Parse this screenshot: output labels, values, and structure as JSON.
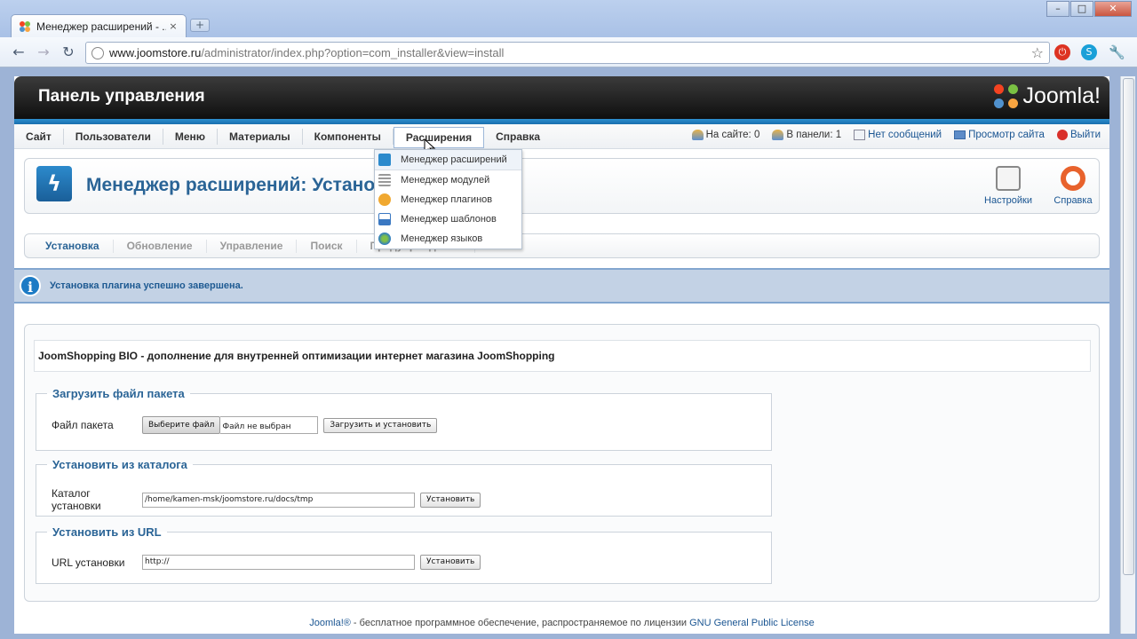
{
  "browser": {
    "tab_title": "Менеджер расширений - ...",
    "tab_close": "×",
    "new_tab": "+",
    "url_domain": "www.joomstore.ru",
    "url_path": "/administrator/index.php?option=com_installer&view=install",
    "win_min": "–",
    "win_max": "□",
    "win_close": "✕"
  },
  "header": {
    "admin_title": "Панель управления",
    "logo_text": "Joomla!"
  },
  "menu": {
    "items": [
      "Сайт",
      "Пользователи",
      "Меню",
      "Материалы",
      "Компоненты",
      "Расширения",
      "Справка"
    ],
    "active_index": 5
  },
  "status": {
    "on_site": "На сайте: 0",
    "in_panel": "В панели: 1",
    "messages": "Нет сообщений",
    "view_site": "Просмотр сайта",
    "logout": "Выйти"
  },
  "dropdown": {
    "items": [
      "Менеджер расширений",
      "Менеджер модулей",
      "Менеджер плагинов",
      "Менеджер шаблонов",
      "Менеджер языков"
    ]
  },
  "toolbar": {
    "page_title": "Менеджер расширений: Установка",
    "settings_label": "Настройки",
    "help_label": "Справка"
  },
  "subtabs": [
    "Установка",
    "Обновление",
    "Управление",
    "Поиск",
    "Предупреждения"
  ],
  "message": "Установка плагина успешно завершена.",
  "install": {
    "description": "JoomShopping BIO - дополнение для внутренней оптимизации интернет магазина JoomShopping",
    "upload": {
      "legend": "Загрузить файл пакета",
      "label": "Файл пакета",
      "choose_button": "Выберите файл",
      "no_file": "Файл не выбран",
      "submit": "Загрузить и установить"
    },
    "directory": {
      "legend": "Установить из каталога",
      "label": "Каталог установки",
      "value": "/home/kamen-msk/joomstore.ru/docs/tmp",
      "submit": "Установить"
    },
    "url": {
      "legend": "Установить из URL",
      "label": "URL установки",
      "value": "http://",
      "submit": "Установить"
    }
  },
  "footer": {
    "brand": "Joomla!®",
    "text": " - бесплатное программное обеспечение, распространяемое по лицензии ",
    "license": "GNU General Public License"
  }
}
